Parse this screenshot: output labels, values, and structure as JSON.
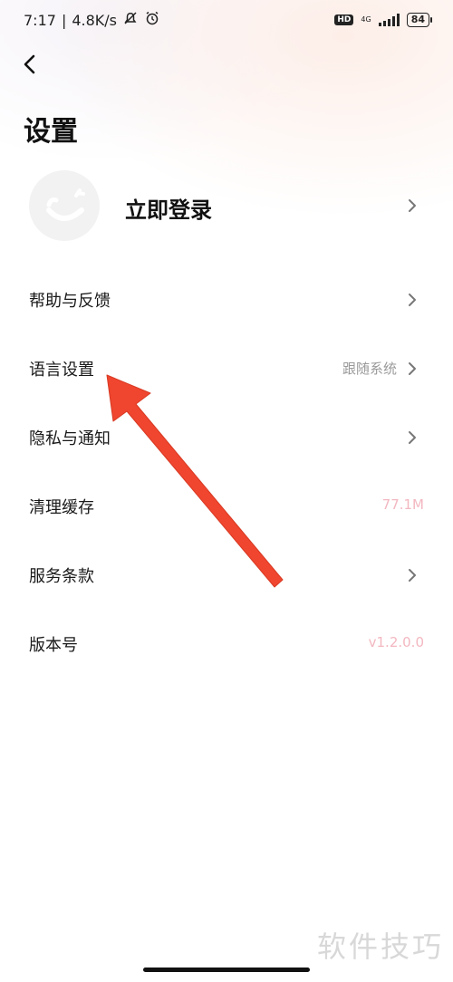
{
  "status_bar": {
    "time": "7:17",
    "speed": "4.8K/s",
    "hd": "HD",
    "network": "4G",
    "battery": "84"
  },
  "header": {
    "title": "设置",
    "back_icon": "chevron-left-icon"
  },
  "login": {
    "label": "立即登录",
    "avatar_icon": "smiley-avatar-icon"
  },
  "menu": [
    {
      "label": "帮助与反馈",
      "value": "",
      "has_chevron": true
    },
    {
      "label": "语言设置",
      "value": "跟随系统",
      "has_chevron": true
    },
    {
      "label": "隐私与通知",
      "value": "",
      "has_chevron": true
    },
    {
      "label": "清理缓存",
      "value": "77.1M",
      "has_chevron": false
    },
    {
      "label": "服务条款",
      "value": "",
      "has_chevron": true
    },
    {
      "label": "版本号",
      "value": "v1.2.0.0",
      "has_chevron": false
    }
  ],
  "watermark": "软件技巧",
  "colors": {
    "annotation_arrow": "#f0452e",
    "secondary_text": "#9a9a9a",
    "pink_value": "#f3b7c0"
  }
}
